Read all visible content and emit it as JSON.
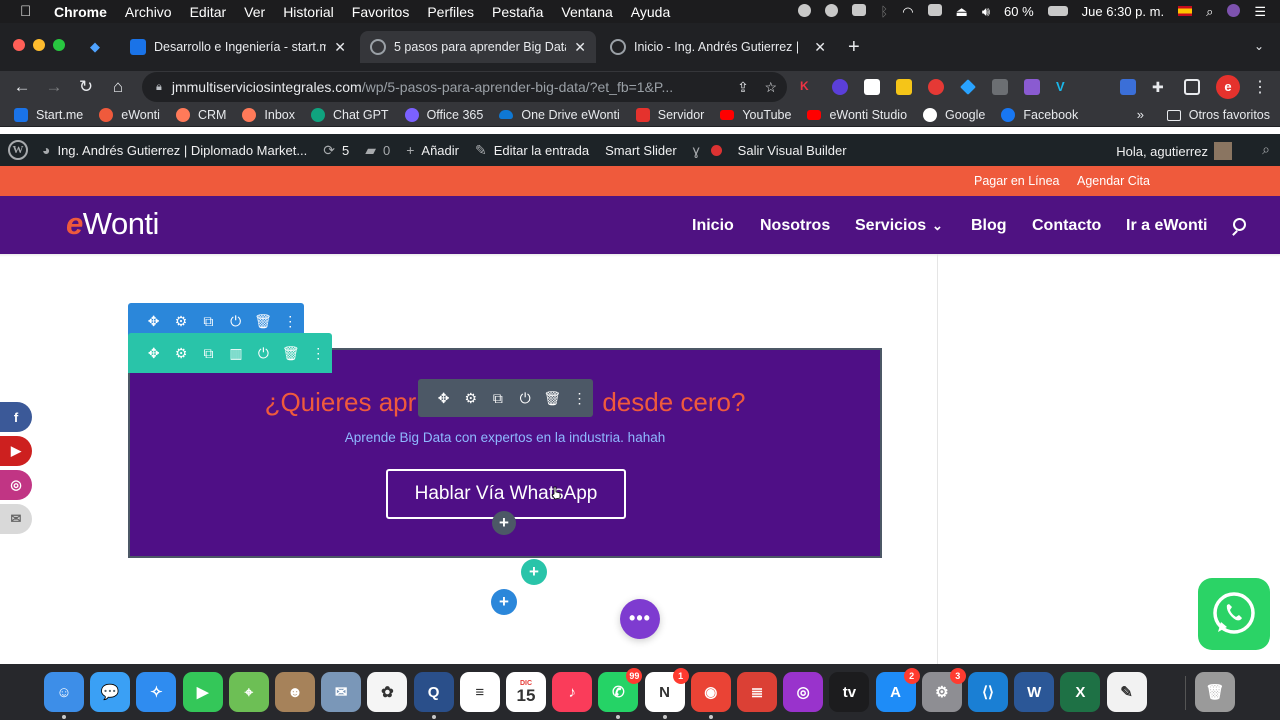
{
  "macos_menubar": {
    "app_name": "Chrome",
    "menus": [
      "Archivo",
      "Editar",
      "Ver",
      "Historial",
      "Favoritos",
      "Perfiles",
      "Pestaña",
      "Ventana",
      "Ayuda"
    ],
    "battery": "60 %",
    "clock": "Jue 6:30 p. m."
  },
  "browser": {
    "tabs": [
      {
        "title": "Desarrollo e Ingeniería - start.m",
        "active": false,
        "favicon_color": "#1a73e8"
      },
      {
        "title": "5 pasos para aprender Big Data",
        "active": true,
        "favicon_color": "#9aa0a6"
      },
      {
        "title": "Inicio - Ing. Andrés Gutierrez |",
        "active": false,
        "favicon_color": "#9aa0a6"
      }
    ],
    "url_host": "jmmultiserviciosintegrales.com",
    "url_path": "/wp/5-pasos-para-aprender-big-data/?et_fb=1&P...",
    "profile_initial": "e"
  },
  "bookmarks": {
    "items": [
      {
        "label": "Start.me",
        "color": "#1a73e8"
      },
      {
        "label": "eWonti",
        "color": "#ef5a3c"
      },
      {
        "label": "CRM",
        "color": "#ff7a59"
      },
      {
        "label": "Inbox",
        "color": "#ff7a59"
      },
      {
        "label": "Chat GPT",
        "color": "#10a37f"
      },
      {
        "label": "Office 365",
        "color": "#7b61ff"
      },
      {
        "label": "One Drive eWonti",
        "color": "#0f78d4"
      },
      {
        "label": "Servidor",
        "color": "#e5322d"
      },
      {
        "label": "YouTube",
        "color": "#ff0000"
      },
      {
        "label": "eWonti Studio",
        "color": "#ff0000"
      },
      {
        "label": "Google",
        "color": "#ffffff"
      },
      {
        "label": "Facebook",
        "color": "#1877f2"
      }
    ],
    "more": "»",
    "other": "Otros favoritos"
  },
  "wp_admin_bar": {
    "site_name": "Ing. Andrés Gutierrez | Diplomado Market...",
    "updates": "5",
    "comments": "0",
    "add_new": "Añadir",
    "edit_post": "Editar la entrada",
    "smart_slider": "Smart Slider",
    "exit_builder": "Salir Visual Builder",
    "greeting": "Hola, agutierrez"
  },
  "site": {
    "topbar_links": [
      "Pagar en Línea",
      "Agendar Cita"
    ],
    "logo_e": "e",
    "logo_rest": "Wonti",
    "nav": [
      "Inicio",
      "Nosotros",
      "Servicios",
      "Blog",
      "Contacto",
      "Ir a eWonti"
    ],
    "nav_dropdown_indicator": "⌄",
    "cta": {
      "title_left": "¿Quieres apr",
      "title_right": "desde cero?",
      "subtitle": "Aprende Big Data con expertos en la industria. hahah",
      "button_label": "Hablar Vía WhatsApp"
    }
  },
  "builder": {
    "section_tools": [
      "✥",
      "⚙",
      "⧉",
      "⏻",
      "🗑",
      "⋮"
    ],
    "row_tools": [
      "✥",
      "⚙",
      "⧉",
      "▥",
      "⏻",
      "🗑",
      "⋮"
    ],
    "module_tools": [
      "✥",
      "⚙",
      "⧉",
      "⏻",
      "🗑",
      "⋮"
    ],
    "plus": "+",
    "dots": "•••"
  },
  "social": [
    {
      "name": "facebook",
      "glyph": "f",
      "color": "#3b5998"
    },
    {
      "name": "youtube",
      "glyph": "▶",
      "color": "#cd201f"
    },
    {
      "name": "instagram",
      "glyph": "◎",
      "color": "#c13584"
    },
    {
      "name": "email",
      "glyph": "✉",
      "color": "#d9d9d9"
    }
  ],
  "dock": {
    "apps": [
      {
        "name": "finder",
        "color": "#3d8ee8",
        "glyph": "☺"
      },
      {
        "name": "messages",
        "color": "#3aa0f5",
        "glyph": "💬"
      },
      {
        "name": "safari",
        "color": "#2f8cf0",
        "glyph": "✧"
      },
      {
        "name": "facetime",
        "color": "#34c759",
        "glyph": "▶"
      },
      {
        "name": "maps",
        "color": "#6dbf55",
        "glyph": "⌖"
      },
      {
        "name": "contacts",
        "color": "#a6825a",
        "glyph": "☻"
      },
      {
        "name": "mail",
        "color": "#7a97b8",
        "glyph": "✉"
      },
      {
        "name": "photos",
        "color": "#f5f5f5",
        "glyph": "✿"
      },
      {
        "name": "quicktime",
        "color": "#2a4f8a",
        "glyph": "Q"
      },
      {
        "name": "reminders",
        "color": "#ffffff",
        "glyph": "≡"
      },
      {
        "name": "calendar",
        "color": "#ffffff",
        "glyph": "15"
      },
      {
        "name": "music",
        "color": "#fa3c5a",
        "glyph": "♪"
      },
      {
        "name": "whatsapp",
        "color": "#25d366",
        "glyph": "✆",
        "badge": "99"
      },
      {
        "name": "notion",
        "color": "#ffffff",
        "glyph": "N",
        "badge": "1"
      },
      {
        "name": "chrome",
        "color": "#ea4335",
        "glyph": "◉"
      },
      {
        "name": "todoist",
        "color": "#db4035",
        "glyph": "≣"
      },
      {
        "name": "podcasts",
        "color": "#9933cc",
        "glyph": "◎"
      },
      {
        "name": "appletv",
        "color": "#1c1c1e",
        "glyph": "tv"
      },
      {
        "name": "appstore",
        "color": "#1e8cf7",
        "glyph": "A",
        "badge": "2"
      },
      {
        "name": "system-preferences",
        "color": "#8e8e93",
        "glyph": "⚙",
        "badge": "3"
      },
      {
        "name": "vscode",
        "color": "#1a7fd4",
        "glyph": "⟨⟩"
      },
      {
        "name": "word",
        "color": "#2b5797",
        "glyph": "W"
      },
      {
        "name": "excel",
        "color": "#1e7145",
        "glyph": "X"
      },
      {
        "name": "textedit",
        "color": "#f2f2f2",
        "glyph": "✎"
      },
      {
        "name": "trash",
        "color": "#9a9a9a",
        "glyph": "🗑"
      }
    ],
    "calendar_month": "DIC",
    "calendar_day": "15"
  }
}
